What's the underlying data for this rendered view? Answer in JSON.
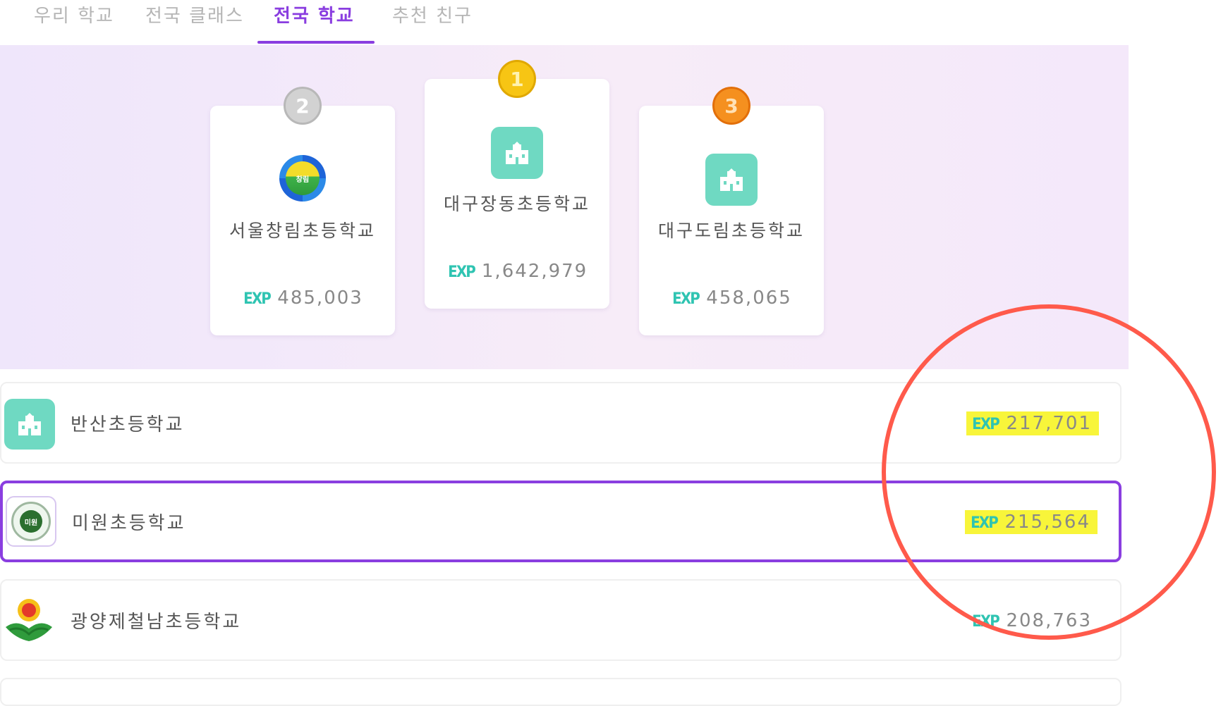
{
  "tabs": [
    {
      "label": "우리 학교",
      "active": false
    },
    {
      "label": "전국 클래스",
      "active": false
    },
    {
      "label": "전국 학교",
      "active": true
    },
    {
      "label": "추천 친구",
      "active": false
    }
  ],
  "exp_label": "EXP",
  "podium": {
    "first": {
      "rank": "1",
      "name": "대구장동초등학교",
      "exp": "1,642,979",
      "icon": "school-building-icon"
    },
    "second": {
      "rank": "2",
      "name": "서울창림초등학교",
      "exp": "485,003",
      "icon": "school-emblem-icon",
      "emblem_text": "창림"
    },
    "third": {
      "rank": "3",
      "name": "대구도림초등학교",
      "exp": "458,065",
      "icon": "school-building-icon"
    }
  },
  "list": [
    {
      "name": "반산초등학교",
      "exp": "217,701",
      "highlighted": true,
      "mine": false,
      "icon": "school-building-icon"
    },
    {
      "name": "미원초등학교",
      "exp": "215,564",
      "highlighted": true,
      "mine": true,
      "icon": "school-emblem-icon",
      "emblem_text": "미원"
    },
    {
      "name": "광양제철남초등학교",
      "exp": "208,763",
      "highlighted": false,
      "mine": false,
      "icon": "school-emblem-icon"
    }
  ],
  "colors": {
    "accent": "#8a3ee0",
    "exp_tag": "#2fc4b2",
    "highlight": "#f8f53a",
    "annotation": "#ff5a4b"
  }
}
